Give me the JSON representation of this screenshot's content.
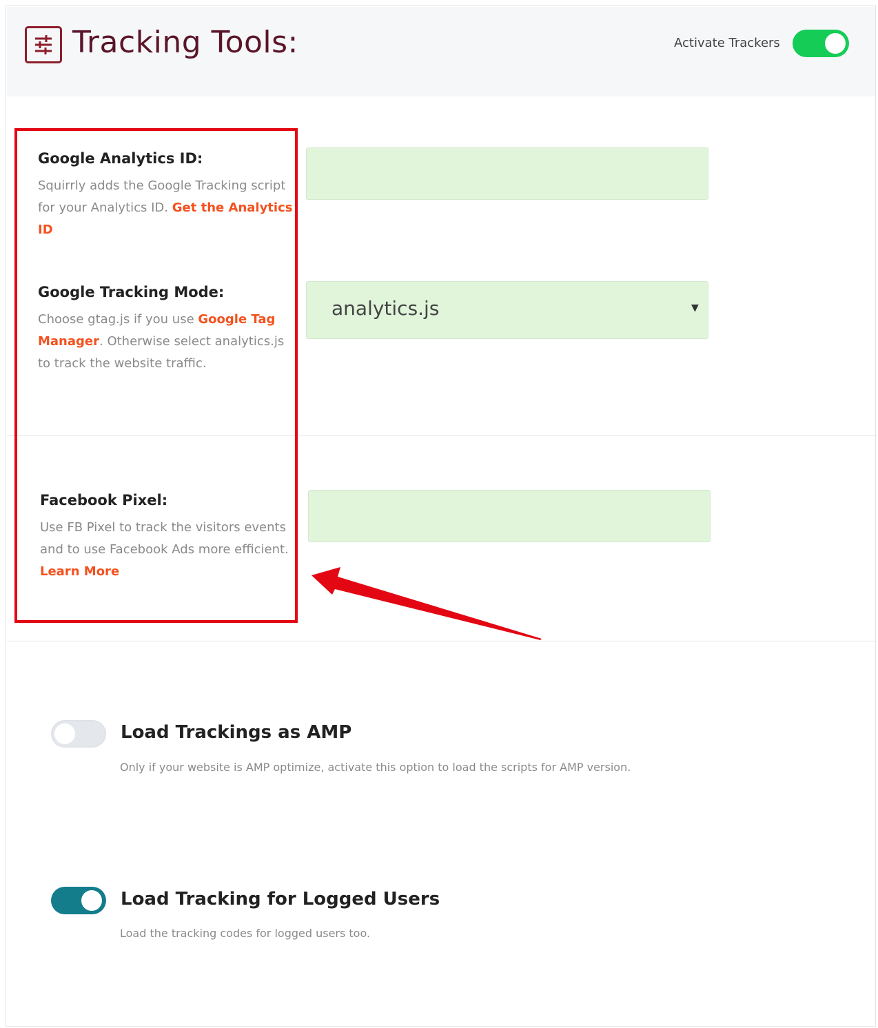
{
  "header": {
    "title": "Tracking Tools:",
    "icon": "settings-sliders-icon",
    "activate_label": "Activate Trackers",
    "activate_on": true
  },
  "fields": {
    "ga_id": {
      "label": "Google Analytics ID:",
      "help_text": "Squirrly adds the Google Tracking script for your Analytics ID.",
      "link_text": "Get the Analytics ID",
      "value": ""
    },
    "tracking_mode": {
      "label": "Google Tracking Mode:",
      "help_before": "Choose gtag.js if you use",
      "link_text": "Google Tag Manager",
      "help_after": ". Otherwise select analytics.js to track the website traffic.",
      "selected": "analytics.js"
    },
    "fb_pixel": {
      "label": "Facebook Pixel:",
      "help_text": "Use FB Pixel to track the visitors events and to use Facebook Ads more efficient.",
      "link_text": "Learn More",
      "value": ""
    }
  },
  "options": {
    "amp": {
      "title": "Load Trackings as AMP",
      "description": "Only if your website is AMP optimize, activate this option to load the scripts for AMP version.",
      "enabled": false
    },
    "logged_users": {
      "title": "Load Tracking for Logged Users",
      "description": "Load the tracking codes for logged users too.",
      "enabled": true
    }
  },
  "colors": {
    "accent_link": "#f4511e",
    "toggle_on_green": "#15cc57",
    "toggle_on_teal": "#137d8c",
    "input_bg": "#e0f5da",
    "annotation_red": "#e30613",
    "title_color": "#5b1528"
  }
}
